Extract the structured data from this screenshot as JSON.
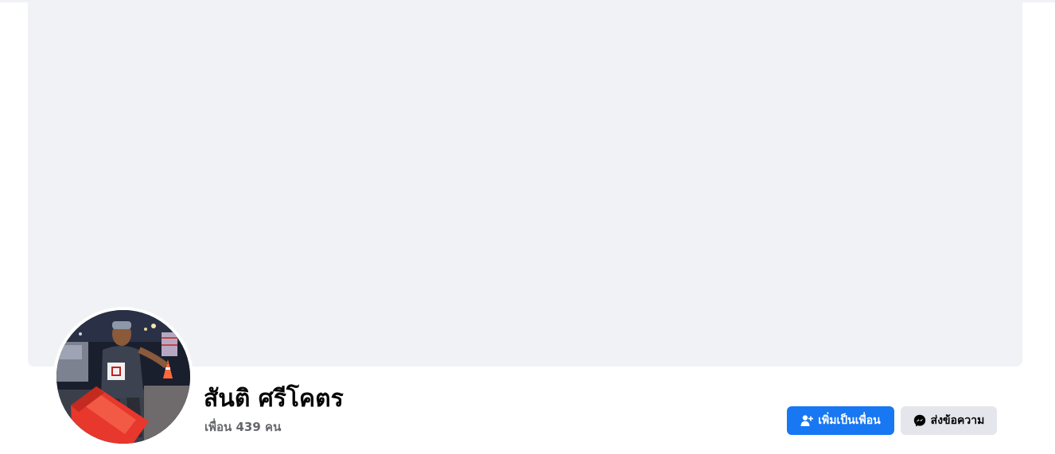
{
  "profile": {
    "name": "สันติ ศรีโคตร",
    "friends_count": "เพื่อน 439 คน"
  },
  "actions": {
    "add_friend_label": "เพิ่มเป็นเพื่อน",
    "add_friend_icon": "add-friend-icon",
    "message_label": "ส่งข้อความ",
    "message_icon": "messenger-icon"
  },
  "colors": {
    "primary": "#1877f2",
    "secondary_button": "#e4e6eb",
    "cover_placeholder": "#f0f2f5",
    "secondary_text": "#65676b"
  }
}
